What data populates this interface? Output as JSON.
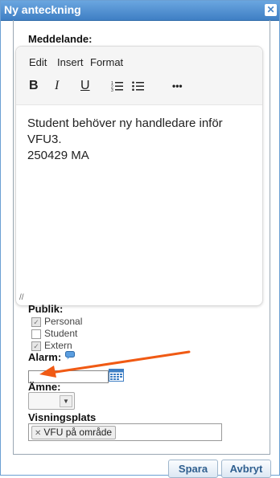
{
  "dialog": {
    "title": "Ny anteckning",
    "close_glyph": "✕",
    "close_icon": "close-icon"
  },
  "message": {
    "label": "Meddelande:",
    "menu": [
      "Edit",
      "Insert",
      "Format"
    ],
    "toolbar": {
      "bold": "B",
      "italic": "I",
      "underline": "U",
      "more": "•••"
    },
    "body_line1": "Student behöver ny handledare inför VFU3.",
    "body_line2": "250429 MA",
    "resize_glyph": "//"
  },
  "audience": {
    "label": "Publik:",
    "options": [
      {
        "label": "Personal",
        "checked": true,
        "disabled": true
      },
      {
        "label": "Student",
        "checked": false,
        "disabled": false
      },
      {
        "label": "Extern",
        "checked": true,
        "disabled": true
      }
    ]
  },
  "alarm": {
    "label": "Alarm:",
    "info_icon": "speech-bubble-icon",
    "value": "",
    "calendar_icon": "calendar-icon"
  },
  "subject": {
    "label": "Ämne:",
    "selected": ""
  },
  "visibility": {
    "label": "Visningsplats",
    "tags": [
      "VFU på område"
    ]
  },
  "buttons": {
    "save": "Spara",
    "cancel": "Avbryt"
  },
  "colors": {
    "accent": "#3f7fc4",
    "arrow": "#f05a14"
  }
}
